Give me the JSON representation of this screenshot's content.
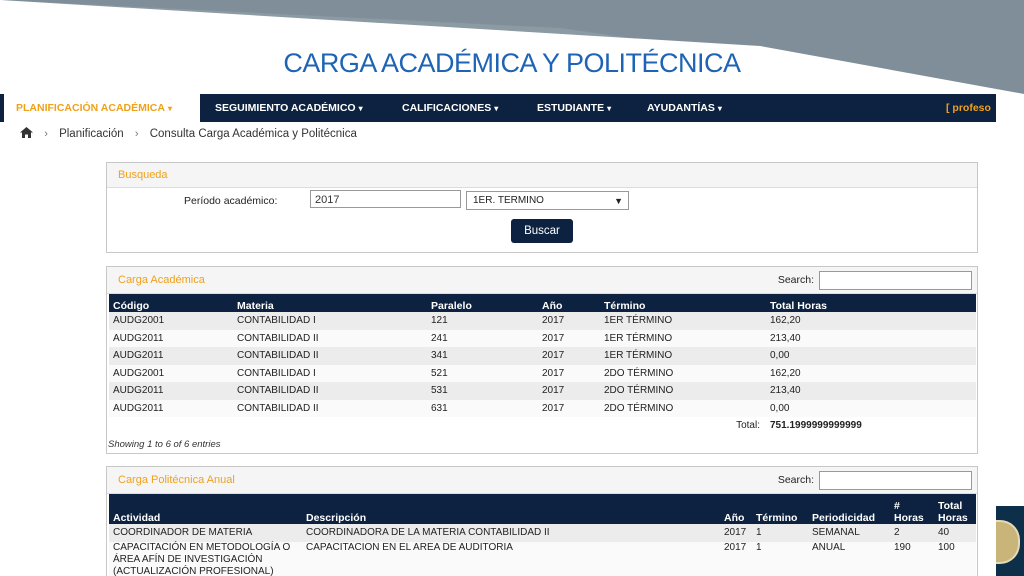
{
  "slide": {
    "title": "CARGA ACADÉMICA Y POLITÉCNICA",
    "colors": {
      "gray_band": "#8c9aa3",
      "title": "#1f64b4",
      "logo_bg": "#0e2f4a"
    }
  },
  "navbar": {
    "items": [
      {
        "label": "PLANIFICACIÓN ACADÉMICA",
        "active": true
      },
      {
        "label": "SEGUIMIENTO ACADÉMICO"
      },
      {
        "label": "CALIFICACIONES"
      },
      {
        "label": "ESTUDIANTE"
      },
      {
        "label": "AYUDANTÍAS"
      }
    ],
    "caret": "▾",
    "user_label": "[ profeso",
    "colors": {
      "bar": "#0d2240",
      "active_text": "#f0a11a"
    }
  },
  "breadcrumb": {
    "home_icon": "home-icon",
    "items": [
      "Planificación",
      "Consulta Carga Académica y Politécnica"
    ],
    "separator": "›"
  },
  "busqueda": {
    "heading": "Busqueda",
    "period_label": "Período académico:",
    "year_value": "2017",
    "term_selected": "1ER. TERMINO",
    "button_label": "Buscar"
  },
  "carga_academica": {
    "heading": "Carga Académica",
    "search_label": "Search:",
    "columns": [
      "Código",
      "Materia",
      "Paralelo",
      "Año",
      "Término",
      "Total Horas"
    ],
    "rows": [
      [
        "AUDG2001",
        "CONTABILIDAD I",
        "121",
        "2017",
        "1ER TÉRMINO",
        "162,20"
      ],
      [
        "AUDG2011",
        "CONTABILIDAD II",
        "241",
        "2017",
        "1ER TÉRMINO",
        "213,40"
      ],
      [
        "AUDG2011",
        "CONTABILIDAD II",
        "341",
        "2017",
        "1ER TÉRMINO",
        "0,00"
      ],
      [
        "AUDG2001",
        "CONTABILIDAD I",
        "521",
        "2017",
        "2DO TÉRMINO",
        "162,20"
      ],
      [
        "AUDG2011",
        "CONTABILIDAD II",
        "531",
        "2017",
        "2DO TÉRMINO",
        "213,40"
      ],
      [
        "AUDG2011",
        "CONTABILIDAD II",
        "631",
        "2017",
        "2DO TÉRMINO",
        "0,00"
      ]
    ],
    "total_label": "Total:",
    "total_value": "751.1999999999999",
    "info": "Showing 1 to 6 of 6 entries"
  },
  "carga_politecnica": {
    "heading": "Carga Politécnica Anual",
    "search_label": "Search:",
    "columns": [
      "Actividad",
      "Descripción",
      "Año",
      "Término",
      "Periodicidad",
      "# Horas",
      "Total Horas"
    ],
    "rows": [
      [
        "COORDINADOR DE MATERIA",
        "COORDINADORA DE LA MATERIA CONTABILIDAD II",
        "2017",
        "1",
        "SEMANAL",
        "2",
        "40"
      ],
      [
        "CAPACITACIÓN EN METODOLOGÍA O ÁREA AFÍN DE INVESTIGACIÓN (ACTUALIZACIÓN PROFESIONAL)",
        "CAPACITACION EN EL AREA DE AUDITORIA",
        "2017",
        "1",
        "ANUAL",
        "190",
        "100"
      ]
    ]
  }
}
